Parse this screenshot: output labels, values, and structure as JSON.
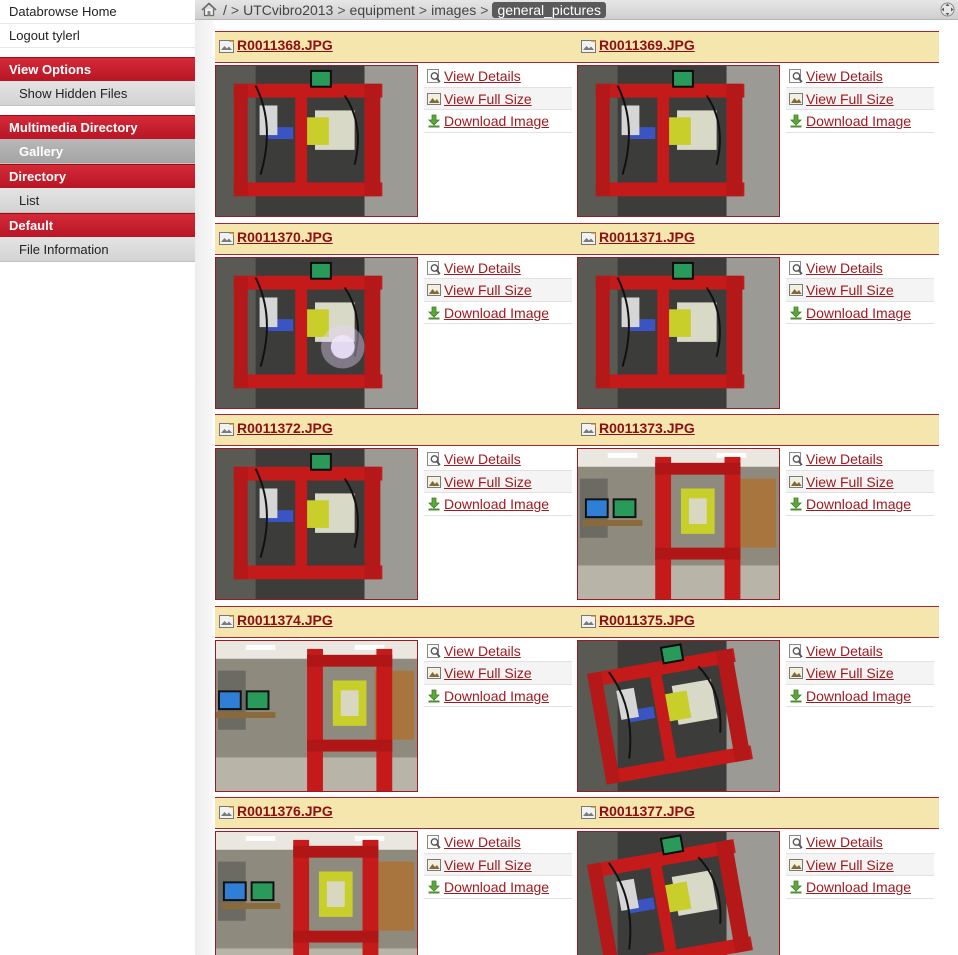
{
  "sidebar": {
    "home_label": "Databrowse Home",
    "logout_label": "Logout tylerl",
    "sections": [
      {
        "title": "View Options",
        "items": [
          {
            "label": "Show Hidden Files",
            "active": false
          }
        ]
      },
      {
        "title": "Multimedia Directory",
        "items": [
          {
            "label": "Gallery",
            "active": true
          }
        ]
      },
      {
        "title": "Directory",
        "items": [
          {
            "label": "List",
            "active": false
          }
        ]
      },
      {
        "title": "Default",
        "items": [
          {
            "label": "File Information",
            "active": false
          }
        ]
      }
    ]
  },
  "breadcrumb": {
    "root": "/",
    "separator": ">",
    "segments": [
      "UTCvibro2013",
      "equipment",
      "images"
    ],
    "current": "general_pictures"
  },
  "actions": {
    "view_details": "View Details",
    "view_full_size": "View Full Size",
    "download_image": "Download Image"
  },
  "gallery": [
    {
      "name": "R0011368.JPG",
      "scene": "top"
    },
    {
      "name": "R0011369.JPG",
      "scene": "top"
    },
    {
      "name": "R0011370.JPG",
      "scene": "top-flash"
    },
    {
      "name": "R0011371.JPG",
      "scene": "top"
    },
    {
      "name": "R0011372.JPG",
      "scene": "top"
    },
    {
      "name": "R0011373.JPG",
      "scene": "front"
    },
    {
      "name": "R0011374.JPG",
      "scene": "side"
    },
    {
      "name": "R0011375.JPG",
      "scene": "tilt"
    },
    {
      "name": "R0011376.JPG",
      "scene": "front"
    },
    {
      "name": "R0011377.JPG",
      "scene": "tilt"
    }
  ],
  "colors": {
    "header_red": "#c41e2c",
    "link_red": "#8b0f14",
    "row_header_bg": "#f5e6ad"
  },
  "icons": {
    "home": "home-icon",
    "expand": "expand-icon",
    "file": "image-file-icon",
    "details": "magnifier-icon",
    "fullsize": "image-icon",
    "download": "download-icon"
  }
}
